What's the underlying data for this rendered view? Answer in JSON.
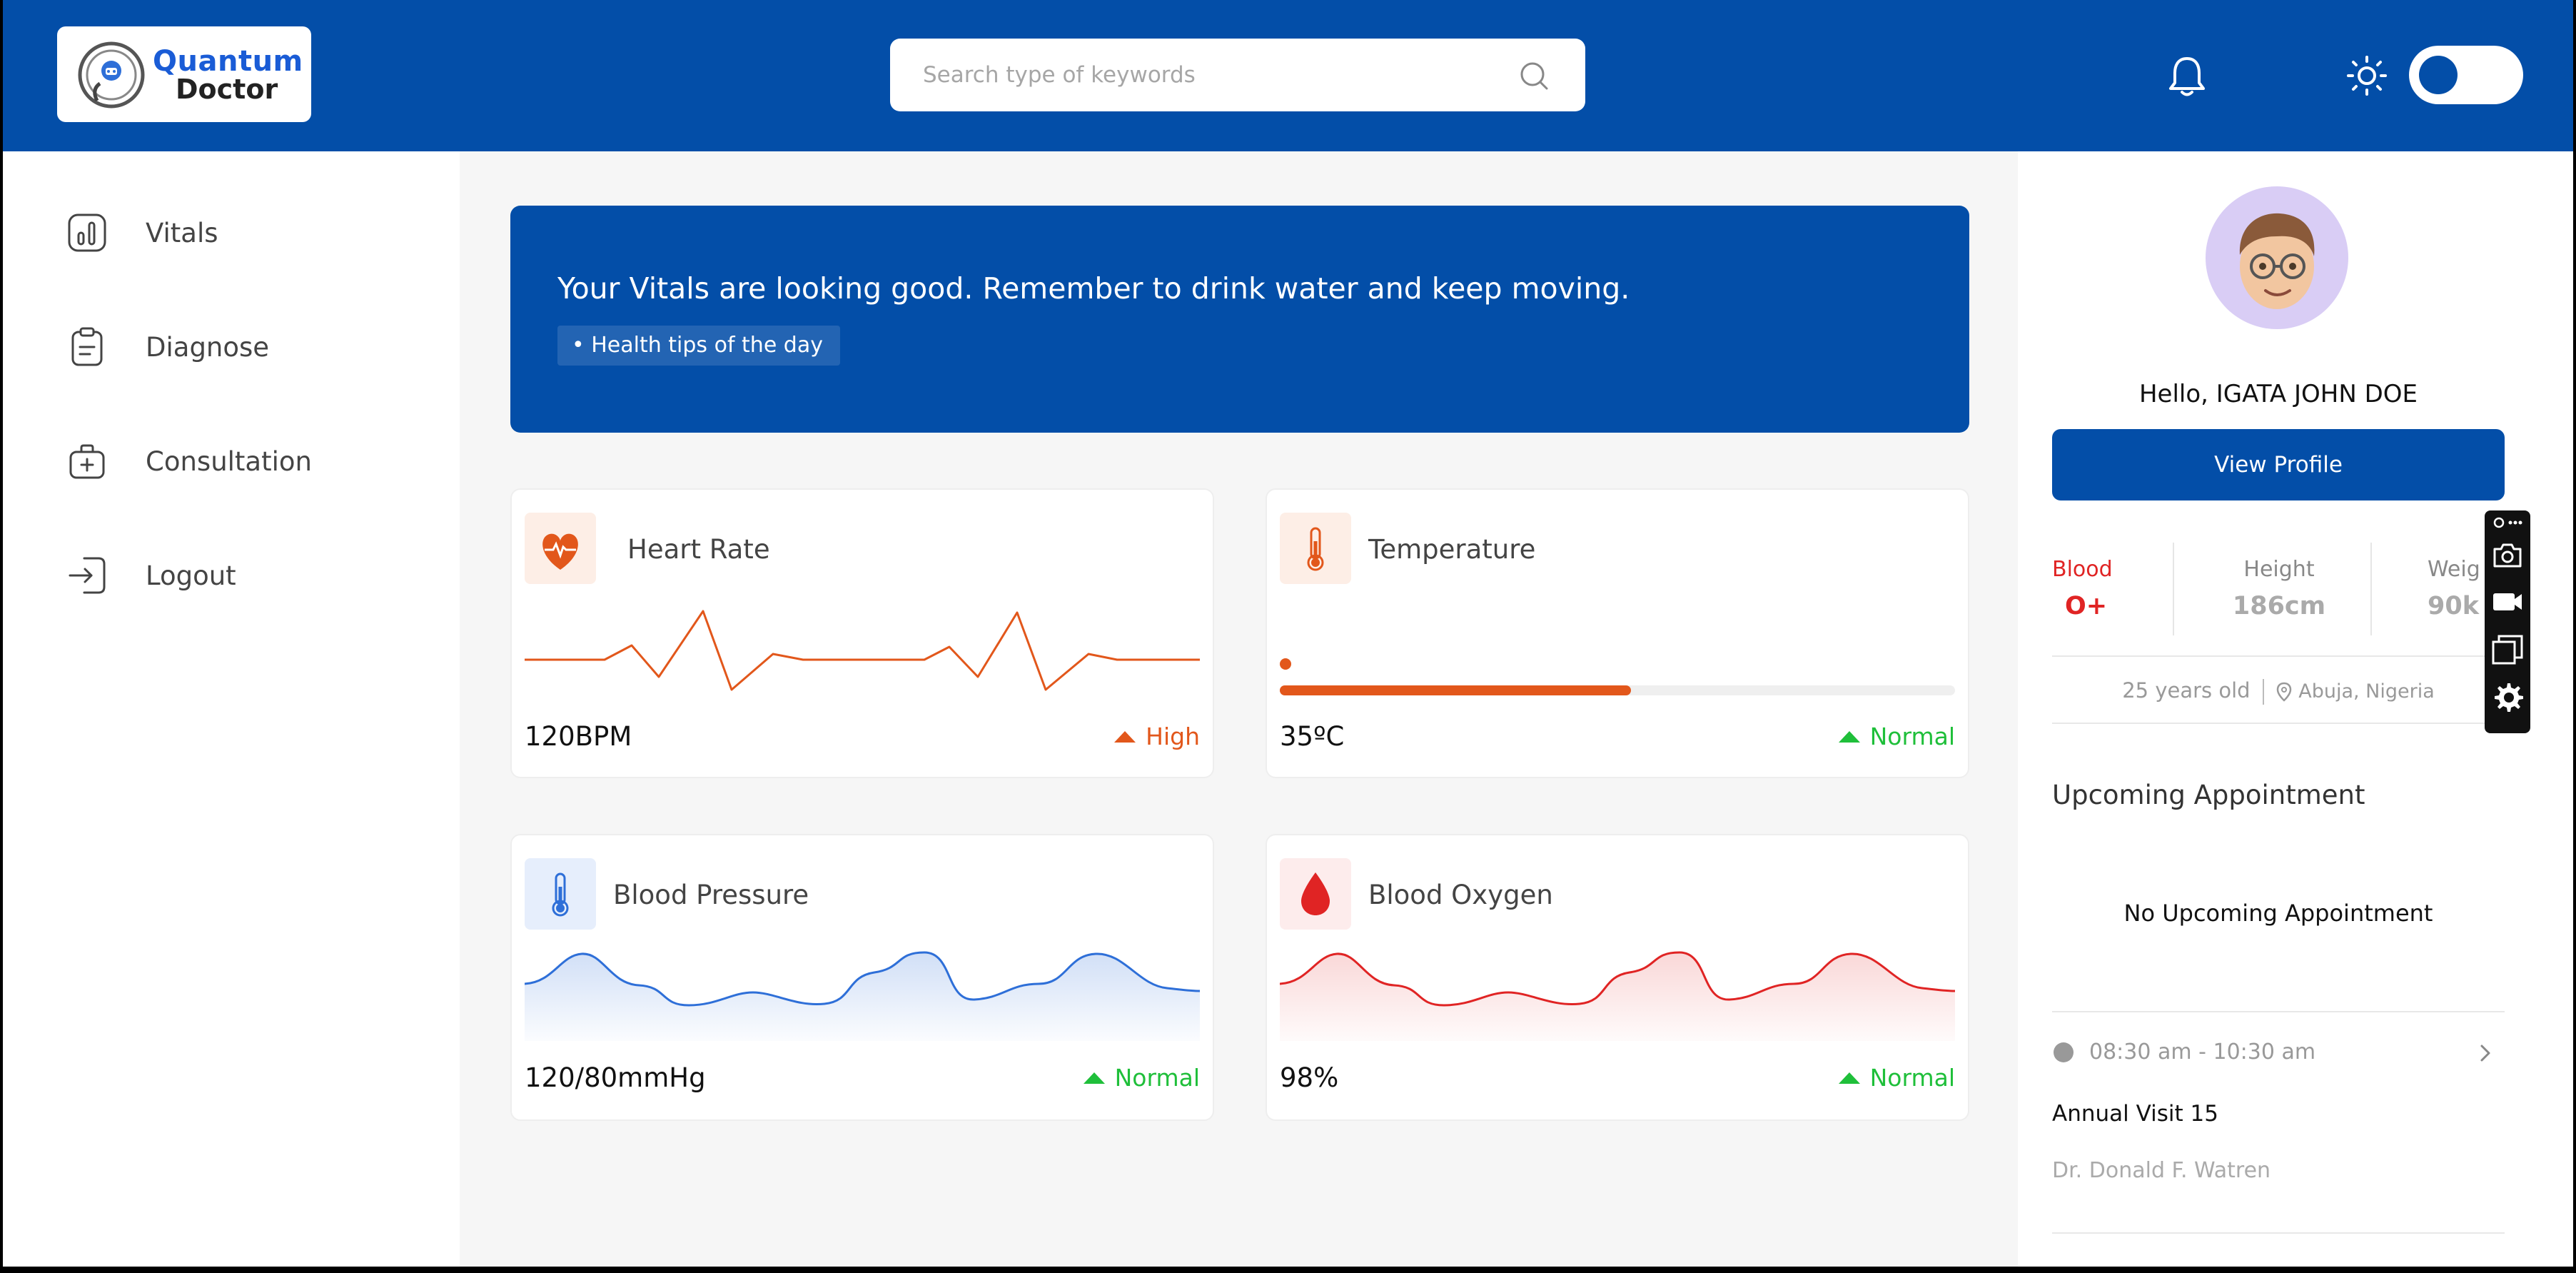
{
  "header": {
    "logo": {
      "line1": "Quantum",
      "line2": "Doctor"
    },
    "search": {
      "placeholder": "Search type of keywords",
      "icon": "search-icon"
    },
    "notifications_icon": "bell-icon",
    "theme_icon": "sun-icon",
    "theme_toggle": "off"
  },
  "sidebar": {
    "items": [
      {
        "label": "Vitals",
        "icon": "chart-icon"
      },
      {
        "label": "Diagnose",
        "icon": "clipboard-icon"
      },
      {
        "label": "Consultation",
        "icon": "medical-kit-icon"
      },
      {
        "label": "Logout",
        "icon": "logout-icon"
      }
    ]
  },
  "banner": {
    "message": "Your Vitals are looking good. Remember to drink water and keep moving.",
    "tag": "• Health tips of the day"
  },
  "cards": {
    "heart_rate": {
      "title": "Heart Rate",
      "value": "120BPM",
      "status": "High",
      "color": "#e2571b"
    },
    "temperature": {
      "title": "Temperature",
      "value": "35ºC",
      "status": "Normal",
      "color": "#e2571b",
      "progress": 0.52
    },
    "blood_pressure": {
      "title": "Blood Pressure",
      "value": "120/80mmHg",
      "status": "Normal",
      "color": "#2e6fd8"
    },
    "blood_oxygen": {
      "title": "Blood Oxygen",
      "value": "98%",
      "status": "Normal",
      "color": "#e02424"
    }
  },
  "status_colors": {
    "normal": "#1fbf3a",
    "high": "#e2571b"
  },
  "profile": {
    "greeting": "Hello, IGATA JOHN DOE",
    "view_profile": "View Profile",
    "stats": [
      {
        "label": "Blood",
        "value": "O+"
      },
      {
        "label": "Height",
        "value": "186cm"
      },
      {
        "label": "Weig",
        "value": "90k"
      }
    ],
    "age": "25 years old",
    "location": "Abuja, Nigeria"
  },
  "appointments": {
    "title": "Upcoming Appointment",
    "empty_message": "No Upcoming Appointment",
    "item": {
      "time": "08:30 am - 10:30 am",
      "name": "Annual Visit 15",
      "doctor": "Dr. Donald F. Watren"
    }
  },
  "brand_color": "#034ea8"
}
